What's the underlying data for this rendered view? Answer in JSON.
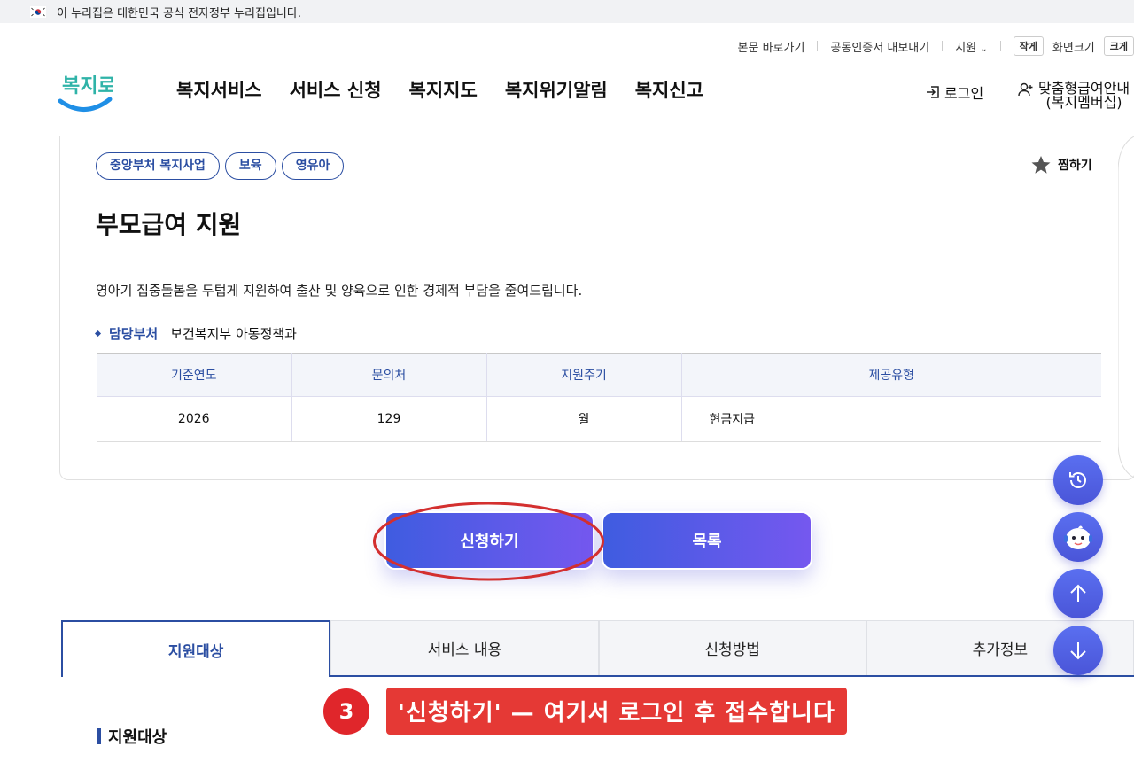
{
  "gov_banner": {
    "text": "이 누리집은 대한민국 공식 전자정부 누리집입니다."
  },
  "utility": {
    "skip_link": "본문 바로가기",
    "cert_export": "공동인증서 내보내기",
    "support": "지원",
    "font_small": "작게",
    "font_size_label": "화면크기",
    "font_large": "크게"
  },
  "header": {
    "logo_text": "복지로",
    "nav": [
      "복지서비스",
      "서비스 신청",
      "복지지도",
      "복지위기알림",
      "복지신고"
    ],
    "login": "로그인",
    "custom_line1": "맞춤형급여안내",
    "custom_line2": "(복지멤버십)"
  },
  "service": {
    "tags": [
      "중앙부처 복지사업",
      "보육",
      "영유아"
    ],
    "favorite": "찜하기",
    "title": "부모급여 지원",
    "description": "영아기 집중돌봄을 두텁게 지원하여 출산 및 양육으로 인한 경제적 부담을 줄여드립니다.",
    "dept_label": "담당부처",
    "dept_value": "보건복지부 아동정책과",
    "table": {
      "headers": [
        "기준연도",
        "문의처",
        "지원주기",
        "제공유형"
      ],
      "row": [
        "2026",
        "129",
        "월",
        "현금지급"
      ]
    }
  },
  "buttons": {
    "apply": "신청하기",
    "list": "목록"
  },
  "tabs": [
    "지원대상",
    "서비스 내용",
    "신청방법",
    "추가정보"
  ],
  "section": {
    "title": "지원대상"
  },
  "callout": {
    "number": "3",
    "message": "'신청하기' — 여기서 로그인 후 접수합니다"
  },
  "colors": {
    "primary": "#2b4ea2",
    "gradient_start": "#3f5ce0",
    "gradient_end": "#7558ef",
    "annotation_red": "#e53935"
  }
}
